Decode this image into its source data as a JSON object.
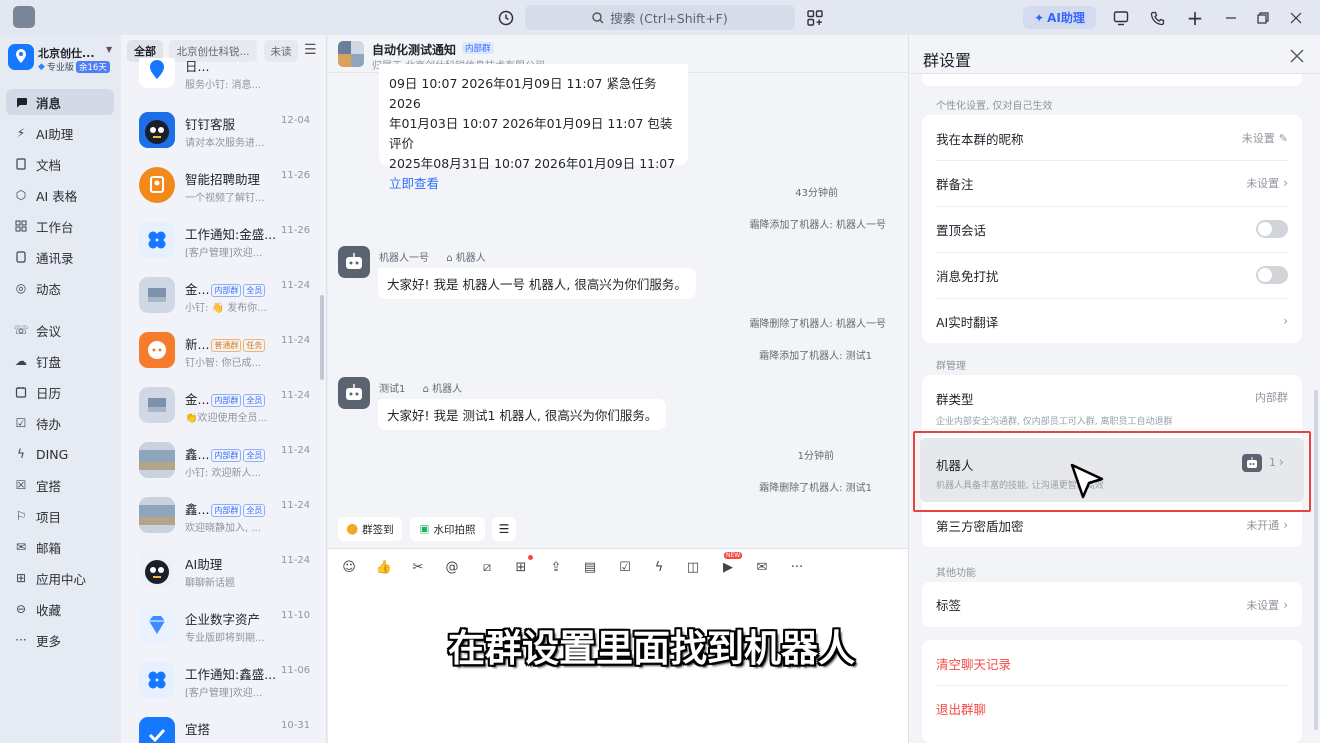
{
  "topbar": {
    "search_placeholder": "搜索 (Ctrl+Shift+F)",
    "ai_button": "AI助理"
  },
  "org": {
    "name": "北京创仕...",
    "tier": "专业版",
    "days": "余16天"
  },
  "nav": {
    "items": [
      {
        "label": "消息",
        "icon": "message-icon",
        "active": true
      },
      {
        "label": "AI助理",
        "icon": "ai-spark-icon"
      },
      {
        "label": "文档",
        "icon": "doc-icon"
      },
      {
        "label": "AI 表格",
        "icon": "table-icon"
      },
      {
        "label": "工作台",
        "icon": "grid-icon"
      },
      {
        "label": "通讯录",
        "icon": "contacts-icon"
      },
      {
        "label": "动态",
        "icon": "feed-icon"
      },
      {
        "label": "会议",
        "icon": "meeting-icon"
      },
      {
        "label": "钉盘",
        "icon": "cloud-icon"
      },
      {
        "label": "日历",
        "icon": "calendar-icon"
      },
      {
        "label": "待办",
        "icon": "todo-icon"
      },
      {
        "label": "DING",
        "icon": "ding-icon"
      },
      {
        "label": "宜搭",
        "icon": "yida-icon"
      },
      {
        "label": "项目",
        "icon": "project-icon"
      },
      {
        "label": "邮箱",
        "icon": "mail-icon"
      },
      {
        "label": "应用中心",
        "icon": "apps-icon"
      },
      {
        "label": "收藏",
        "icon": "bookmark-icon"
      },
      {
        "label": "更多",
        "icon": "more-icon"
      }
    ]
  },
  "filters": {
    "all": "全部",
    "org": "北京创仕科锐...",
    "unread": "未读"
  },
  "conversations": [
    {
      "name": "日...",
      "time": "",
      "preview": "服务小钉: 消息...",
      "avatar": "blue-pin"
    },
    {
      "name": "钉钉客服",
      "time": "12-04",
      "preview": "请对本次服务进...",
      "avatar": "dark-bird"
    },
    {
      "name": "智能招聘助理",
      "time": "11-26",
      "preview": "一个视频了解钉...",
      "avatar": "orange"
    },
    {
      "name": "工作通知:金盛...",
      "time": "11-26",
      "preview": "[客户管理]欢迎...",
      "avatar": "blue-clover"
    },
    {
      "name": "金...",
      "time": "11-24",
      "preview": "小钉: 👋 发布你...",
      "avatar": "photo",
      "tags": [
        "内部群",
        "全员"
      ]
    },
    {
      "name": "新...",
      "time": "11-24",
      "preview": "钉小智: 你已成...",
      "avatar": "orange-chat",
      "tags": [
        "普通群",
        "任务"
      ],
      "orange": true
    },
    {
      "name": "金...",
      "time": "11-24",
      "preview": "👏欢迎使用全员...",
      "avatar": "photo",
      "tags": [
        "内部群",
        "全员"
      ]
    },
    {
      "name": "鑫...",
      "time": "11-24",
      "preview": "小钉: 欢迎新人...",
      "avatar": "photo2",
      "tags": [
        "内部群",
        "全员"
      ]
    },
    {
      "name": "鑫...",
      "time": "11-24",
      "preview": "欢迎晓静加入, ...",
      "avatar": "photo2",
      "tags": [
        "内部群",
        "全员"
      ]
    },
    {
      "name": "AI助理",
      "time": "11-24",
      "preview": "聊聊新话题",
      "avatar": "dark-bird"
    },
    {
      "name": "企业数字资产",
      "time": "11-10",
      "preview": "专业版即将到期...",
      "avatar": "diamond"
    },
    {
      "name": "工作通知:鑫盛...",
      "time": "11-06",
      "preview": "[客户管理]欢迎...",
      "avatar": "blue-clover"
    },
    {
      "name": "宜搭",
      "time": "10-31",
      "preview": "",
      "avatar": "blue-check"
    }
  ],
  "chat": {
    "title": "自动化测试通知",
    "tag": "内部群",
    "subtitle": "归属于 北京创仕科锐信息技术有限公司",
    "card_lines": [
      "09日 10:07 2026年01月09日 11:07 紧急任务 2026",
      "年01月03日 10:07 2026年01月09日 11:07 包装评价",
      "2025年08月31日 10:07 2026年01月09日 11:07"
    ],
    "card_link": "立即查看",
    "time1": "43分钟前",
    "sys1": "霜降添加了机器人: 机器人一号",
    "bot1_name": "机器人一号",
    "bot_tag": "机器人",
    "bot1_msg": "大家好! 我是 机器人一号 机器人, 很高兴为你们服务。",
    "sys2": "霜降删除了机器人: 机器人一号",
    "sys3": "霜降添加了机器人: 测试1",
    "bot2_name": "测试1",
    "bot2_msg": "大家好! 我是 测试1 机器人, 很高兴为你们服务。",
    "time2": "1分钟前",
    "sys4": "霜降删除了机器人: 测试1",
    "quick1": "群签到",
    "quick2": "水印拍照",
    "new_badge": "NEW"
  },
  "overlay_subtitle": "在群设置里面找到机器人",
  "settings": {
    "title": "群设置",
    "personal_label": "个性化设置, 仅对自己生效",
    "nickname": {
      "label": "我在本群的昵称",
      "value": "未设置"
    },
    "remark": {
      "label": "群备注",
      "value": "未设置"
    },
    "pin": {
      "label": "置顶会话"
    },
    "mute": {
      "label": "消息免打扰"
    },
    "translate": {
      "label": "AI实时翻译"
    },
    "manage_label": "群管理",
    "group_type": {
      "label": "群类型",
      "value": "内部群",
      "desc": "企业内部安全沟通群, 仅内部员工可入群, 离职员工自动退群"
    },
    "robot": {
      "label": "机器人",
      "value": "1",
      "desc": "机器人具备丰富的技能, 让沟通更智能高效"
    },
    "encryption": {
      "label": "第三方密盾加密",
      "value": "未开通"
    },
    "other_label": "其他功能",
    "tags": {
      "label": "标签",
      "value": "未设置"
    },
    "clear_history": "清空聊天记录",
    "leave_group": "退出群聊"
  }
}
